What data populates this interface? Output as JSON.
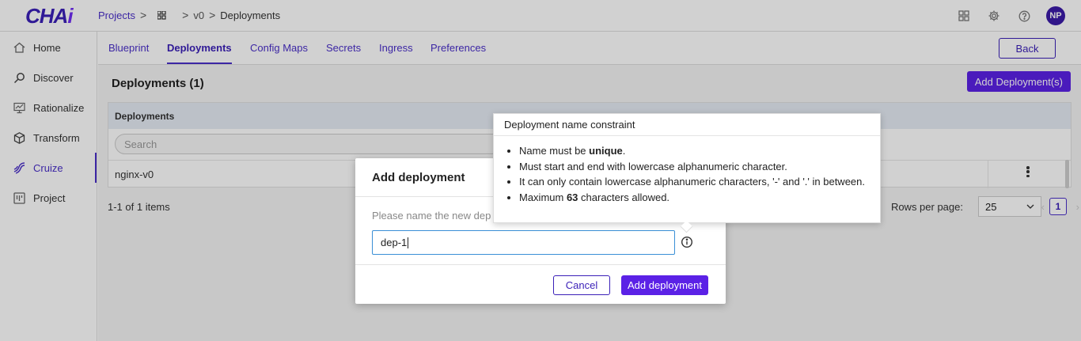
{
  "app": {
    "logo_main": "CHA",
    "logo_accent": "i"
  },
  "breadcrumb": {
    "projects": "Projects",
    "sep1": ">",
    "sep2": ">",
    "version": "v0",
    "sep3": ">",
    "current": "Deployments"
  },
  "user": {
    "initials": "NP"
  },
  "sidebar": {
    "items": [
      {
        "label": "Home",
        "icon": "home-icon"
      },
      {
        "label": "Discover",
        "icon": "discover-icon"
      },
      {
        "label": "Rationalize",
        "icon": "rationalize-icon"
      },
      {
        "label": "Transform",
        "icon": "cube-icon"
      },
      {
        "label": "Cruize",
        "icon": "cruize-icon"
      },
      {
        "label": "Project",
        "icon": "project-icon"
      }
    ]
  },
  "tabs": [
    "Blueprint",
    "Deployments",
    "Config Maps",
    "Secrets",
    "Ingress",
    "Preferences"
  ],
  "back_label": "Back",
  "page": {
    "title": "Deployments (1)",
    "add_button": "Add Deployment(s)"
  },
  "table": {
    "header": "Deployments",
    "search_placeholder": "Search",
    "rows": [
      {
        "name": "nginx-v0"
      }
    ]
  },
  "pagination": {
    "summary": "1-1 of 1 items",
    "rows_per_page_label": "Rows per page:",
    "rows_per_page": "25",
    "page": "1"
  },
  "modal": {
    "title": "Add deployment",
    "label": "Please name the new dep",
    "value": "dep-1",
    "cancel": "Cancel",
    "confirm": "Add deployment"
  },
  "tooltip": {
    "title": "Deployment name constraint",
    "rules": {
      "r1_pre": "Name must be ",
      "r1_bold": "unique",
      "r1_post": ".",
      "r2": "Must start and end with lowercase alphanumeric character.",
      "r3": "It can only contain lowercase alphanumeric characters, '-' and '.' in between.",
      "r4_pre": "Maximum ",
      "r4_bold": "63",
      "r4_post": " characters allowed."
    }
  },
  "colors": {
    "primary": "#5b21e6",
    "link": "#4a2fc9",
    "avatar": "#3b1aa8"
  }
}
